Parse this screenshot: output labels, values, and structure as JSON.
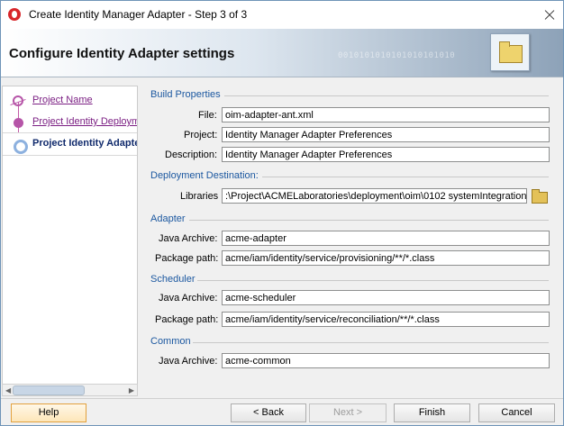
{
  "window": {
    "title": "Create Identity Manager Adapter - Step 3 of 3",
    "close_icon": "close-icon"
  },
  "banner": {
    "title": "Configure Identity Adapter settings",
    "binary": "0010101010101010101010",
    "icon": "folder-icon"
  },
  "nav": {
    "items": [
      {
        "label": "Project Name",
        "state": "visited"
      },
      {
        "label": "Project Identity Deployment",
        "state": "visited"
      },
      {
        "label": "Project Identity Adapter Settings",
        "state": "current"
      }
    ]
  },
  "form": {
    "build": {
      "title": "Build Properties",
      "file_label": "File:",
      "file_value": "oim-adapter-ant.xml",
      "project_label": "Project:",
      "project_value": "Identity Manager Adapter Preferences",
      "description_label": "Description:",
      "description_value": "Identity Manager Adapter Preferences"
    },
    "deployment": {
      "title": "Deployment Destination:",
      "libraries_label": "Libraries",
      "libraries_value": ":\\Project\\ACMELaboratories\\deployment\\oim\\0102 systemIntegration",
      "browse_icon": "folder-icon"
    },
    "adapter": {
      "title": "Adapter",
      "java_label": "Java Archive:",
      "java_value": "acme-adapter",
      "package_label": "Package path:",
      "package_value": "acme/iam/identity/service/provisioning/**/*.class"
    },
    "scheduler": {
      "title": "Scheduler",
      "java_label": "Java Archive:",
      "java_value": "acme-scheduler",
      "package_label": "Package path:",
      "package_value": "acme/iam/identity/service/reconciliation/**/*.class"
    },
    "common": {
      "title": "Common",
      "java_label": "Java Archive:",
      "java_value": "acme-common"
    }
  },
  "buttons": {
    "help": "Help",
    "back": "< Back",
    "next": "Next >",
    "finish": "Finish",
    "cancel": "Cancel"
  }
}
